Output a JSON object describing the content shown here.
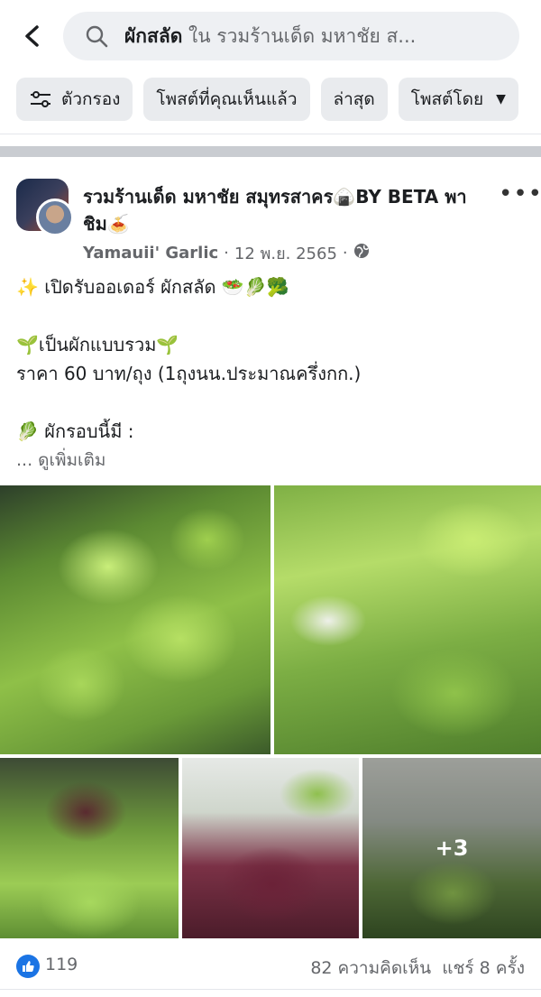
{
  "search": {
    "query": "ผักสลัด",
    "scope": " ใน รวมร้านเด็ด มหาชัย ส..."
  },
  "filters": [
    {
      "label": "ตัวกรอง",
      "icon": "sliders-icon"
    },
    {
      "label": "โพสต์ที่คุณเห็นแล้ว"
    },
    {
      "label": "ล่าสุด"
    },
    {
      "label": "โพสต์โดย",
      "icon": "caret-down-icon"
    }
  ],
  "post": {
    "group_name": "รวมร้านเด็ด มหาชัย สมุทรสาคร🍙BY BETA พาชิม🍝",
    "author": "Yamauii' Garlic",
    "date": "12 พ.ย. 2565",
    "audience_icon": "globe-icon",
    "lines": [
      "✨ เปิดรับออเดอร์ ผักสลัด 🥗🥬🥦",
      "",
      "🌱เป็นผักแบบรวม🌱",
      "ราคา 60 บาท/ถุง (1ถุงนน.ประมาณครึ่งกก.)",
      "",
      "🥬 ผักรอบนี้มี :"
    ],
    "see_more": "... ดูเพิ่มเติม",
    "more_photos": "+3",
    "likes": "119",
    "comments": "82 ความคิดเห็น",
    "shares": "แชร์ 8 ครั้ง"
  }
}
